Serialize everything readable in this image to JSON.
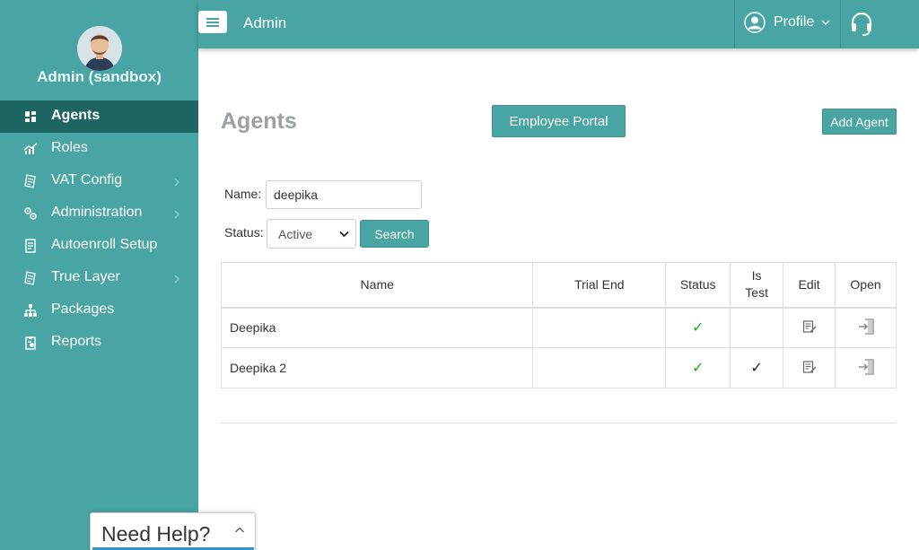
{
  "colors": {
    "accent": "#48a5a3",
    "active_nav": "#1c6563",
    "check_green": "#19b019"
  },
  "sidebar": {
    "user_name": "Admin (sandbox)",
    "items": [
      {
        "label": "Agents",
        "icon": "dashboard-icon",
        "active": true,
        "has_submenu": false
      },
      {
        "label": "Roles",
        "icon": "chart-icon",
        "active": false,
        "has_submenu": false
      },
      {
        "label": "VAT Config",
        "icon": "receipt-icon",
        "active": false,
        "has_submenu": true
      },
      {
        "label": "Administration",
        "icon": "gears-icon",
        "active": false,
        "has_submenu": true
      },
      {
        "label": "Autoenroll Setup",
        "icon": "document-icon",
        "active": false,
        "has_submenu": false
      },
      {
        "label": "True Layer",
        "icon": "receipt-icon",
        "active": false,
        "has_submenu": true
      },
      {
        "label": "Packages",
        "icon": "hierarchy-icon",
        "active": false,
        "has_submenu": false
      },
      {
        "label": "Reports",
        "icon": "clipboard-icon",
        "active": false,
        "has_submenu": false
      }
    ]
  },
  "topbar": {
    "title": "Admin",
    "profile_label": "Profile"
  },
  "main": {
    "title": "Agents",
    "employee_portal_label": "Employee Portal",
    "add_agent_label": "Add Agent",
    "filters": {
      "name_label": "Name:",
      "name_value": "deepika",
      "status_label": "Status:",
      "status_value": "Active",
      "search_label": "Search"
    },
    "table": {
      "headers": [
        "Name",
        "Trial End",
        "Status",
        "Is Test",
        "Edit",
        "Open"
      ],
      "rows": [
        {
          "name": "Deepika",
          "trial_end": "",
          "status": "✓",
          "is_test": ""
        },
        {
          "name": "Deepika 2",
          "trial_end": "",
          "status": "✓",
          "is_test": "✓"
        }
      ]
    }
  },
  "help_widget": {
    "title": "Need Help?"
  }
}
